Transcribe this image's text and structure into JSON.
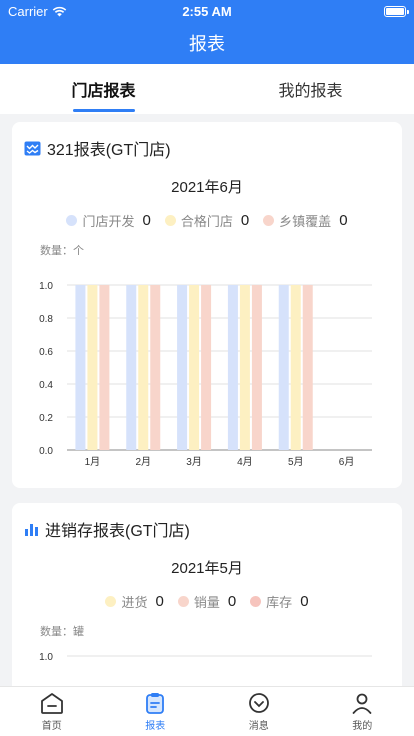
{
  "status": {
    "carrier": "Carrier",
    "time": "2:55 AM"
  },
  "nav": {
    "title": "报表"
  },
  "tabs": [
    {
      "label": "门店报表",
      "active": true
    },
    {
      "label": "我的报表",
      "active": false
    }
  ],
  "card1": {
    "title": "321报表(GT门店)",
    "month": "2021年6月",
    "legend": [
      {
        "label": "门店开发",
        "value": "0",
        "color": "#d6e2fb"
      },
      {
        "label": "合格门店",
        "value": "0",
        "color": "#fdf0c2"
      },
      {
        "label": "乡镇覆盖",
        "value": "0",
        "color": "#f8d5cb"
      }
    ],
    "unit": "数量：个"
  },
  "card2": {
    "title": "进销存报表(GT门店)",
    "month": "2021年5月",
    "legend": [
      {
        "label": "进货",
        "value": "0",
        "color": "#fdf0c2"
      },
      {
        "label": "销量",
        "value": "0",
        "color": "#f8d5cb"
      },
      {
        "label": "库存",
        "value": "0",
        "color": "#f6c4bd"
      }
    ],
    "unit": "数量：罐"
  },
  "chart_data": [
    {
      "type": "bar",
      "categories": [
        "1月",
        "2月",
        "3月",
        "4月",
        "5月",
        "6月"
      ],
      "series": [
        {
          "name": "门店开发",
          "values": [
            1,
            1,
            1,
            1,
            1,
            0
          ]
        },
        {
          "name": "合格门店",
          "values": [
            1,
            1,
            1,
            1,
            1,
            0
          ]
        },
        {
          "name": "乡镇覆盖",
          "values": [
            1,
            1,
            1,
            1,
            1,
            0
          ]
        }
      ],
      "yticks": [
        "0.0",
        "0.2",
        "0.4",
        "0.6",
        "0.8",
        "1.0"
      ],
      "ylim": [
        0,
        1
      ],
      "colors": [
        "#d6e2fb",
        "#fdf0c2",
        "#f8d5cb"
      ],
      "grid": true
    },
    {
      "type": "bar",
      "yticks": [
        "1.0"
      ],
      "ylim": [
        0,
        1
      ]
    }
  ],
  "tabbar": [
    {
      "label": "首页",
      "icon": "home-icon",
      "active": false
    },
    {
      "label": "报表",
      "icon": "report-icon",
      "active": true
    },
    {
      "label": "消息",
      "icon": "message-icon",
      "active": false
    },
    {
      "label": "我的",
      "icon": "profile-icon",
      "active": false
    }
  ]
}
